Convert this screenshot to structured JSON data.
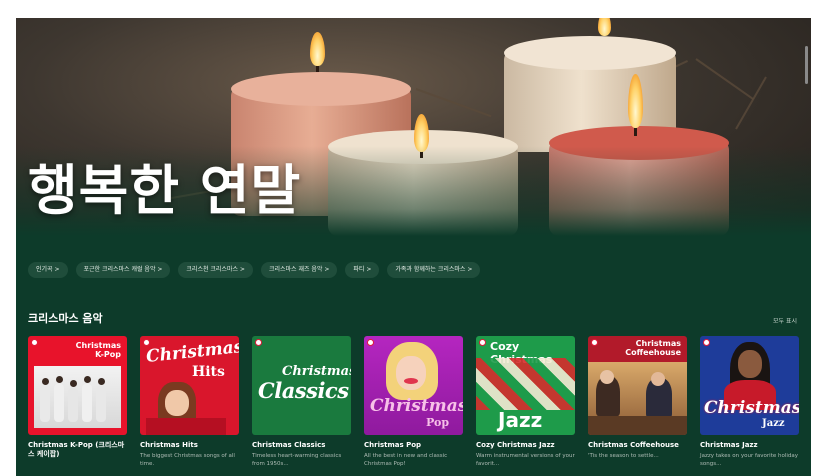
{
  "hero": {
    "title": "행복한 연말"
  },
  "chips": [
    {
      "label": "인기곡 >"
    },
    {
      "label": "포근한 크리스마스 캐럴 음악 >"
    },
    {
      "label": "크리스천 크리스마스 >"
    },
    {
      "label": "크리스마스 재즈 음악 >"
    },
    {
      "label": "파티 >"
    },
    {
      "label": "가족과 함께하는 크리스마스 >"
    }
  ],
  "section": {
    "title": "크리스마스 음악",
    "show_all": "모두 표시"
  },
  "cards": [
    {
      "title": "Christmas K-Pop (크리스마스 케이팝)",
      "desc": "",
      "cover_line1": "Christmas",
      "cover_line2": "K-Pop",
      "color": "#e8132b"
    },
    {
      "title": "Christmas Hits",
      "desc": "The biggest Christmas songs of all time.",
      "cover_line1": "Christmas",
      "cover_line2": "Hits",
      "color": "#d9162c"
    },
    {
      "title": "Christmas Classics",
      "desc": "Timeless heart-warming classics from 1950s...",
      "cover_line1": "Christmas",
      "cover_line2": "Classics",
      "color": "#1a7a3e"
    },
    {
      "title": "Christmas Pop",
      "desc": "All the best in new and classic Christmas Pop!",
      "cover_line1": "Christmas",
      "cover_line2": "Pop",
      "color": "#a41fb0"
    },
    {
      "title": "Cozy Christmas Jazz",
      "desc": "Warm instrumental versions of your favorit...",
      "cover_line1": "Cozy Christmas",
      "cover_line2": "Jazz",
      "color": "#1e9b4a"
    },
    {
      "title": "Christmas Coffeehouse",
      "desc": "'Tis the season to settle...",
      "cover_line1": "Christmas",
      "cover_line2": "Coffeehouse",
      "color": "#b21a2a"
    },
    {
      "title": "Christmas Jazz",
      "desc": "Jazzy takes on your favorite holiday songs...",
      "cover_line1": "Christmas",
      "cover_line2": "Jazz",
      "color": "#1e3c9a"
    }
  ]
}
